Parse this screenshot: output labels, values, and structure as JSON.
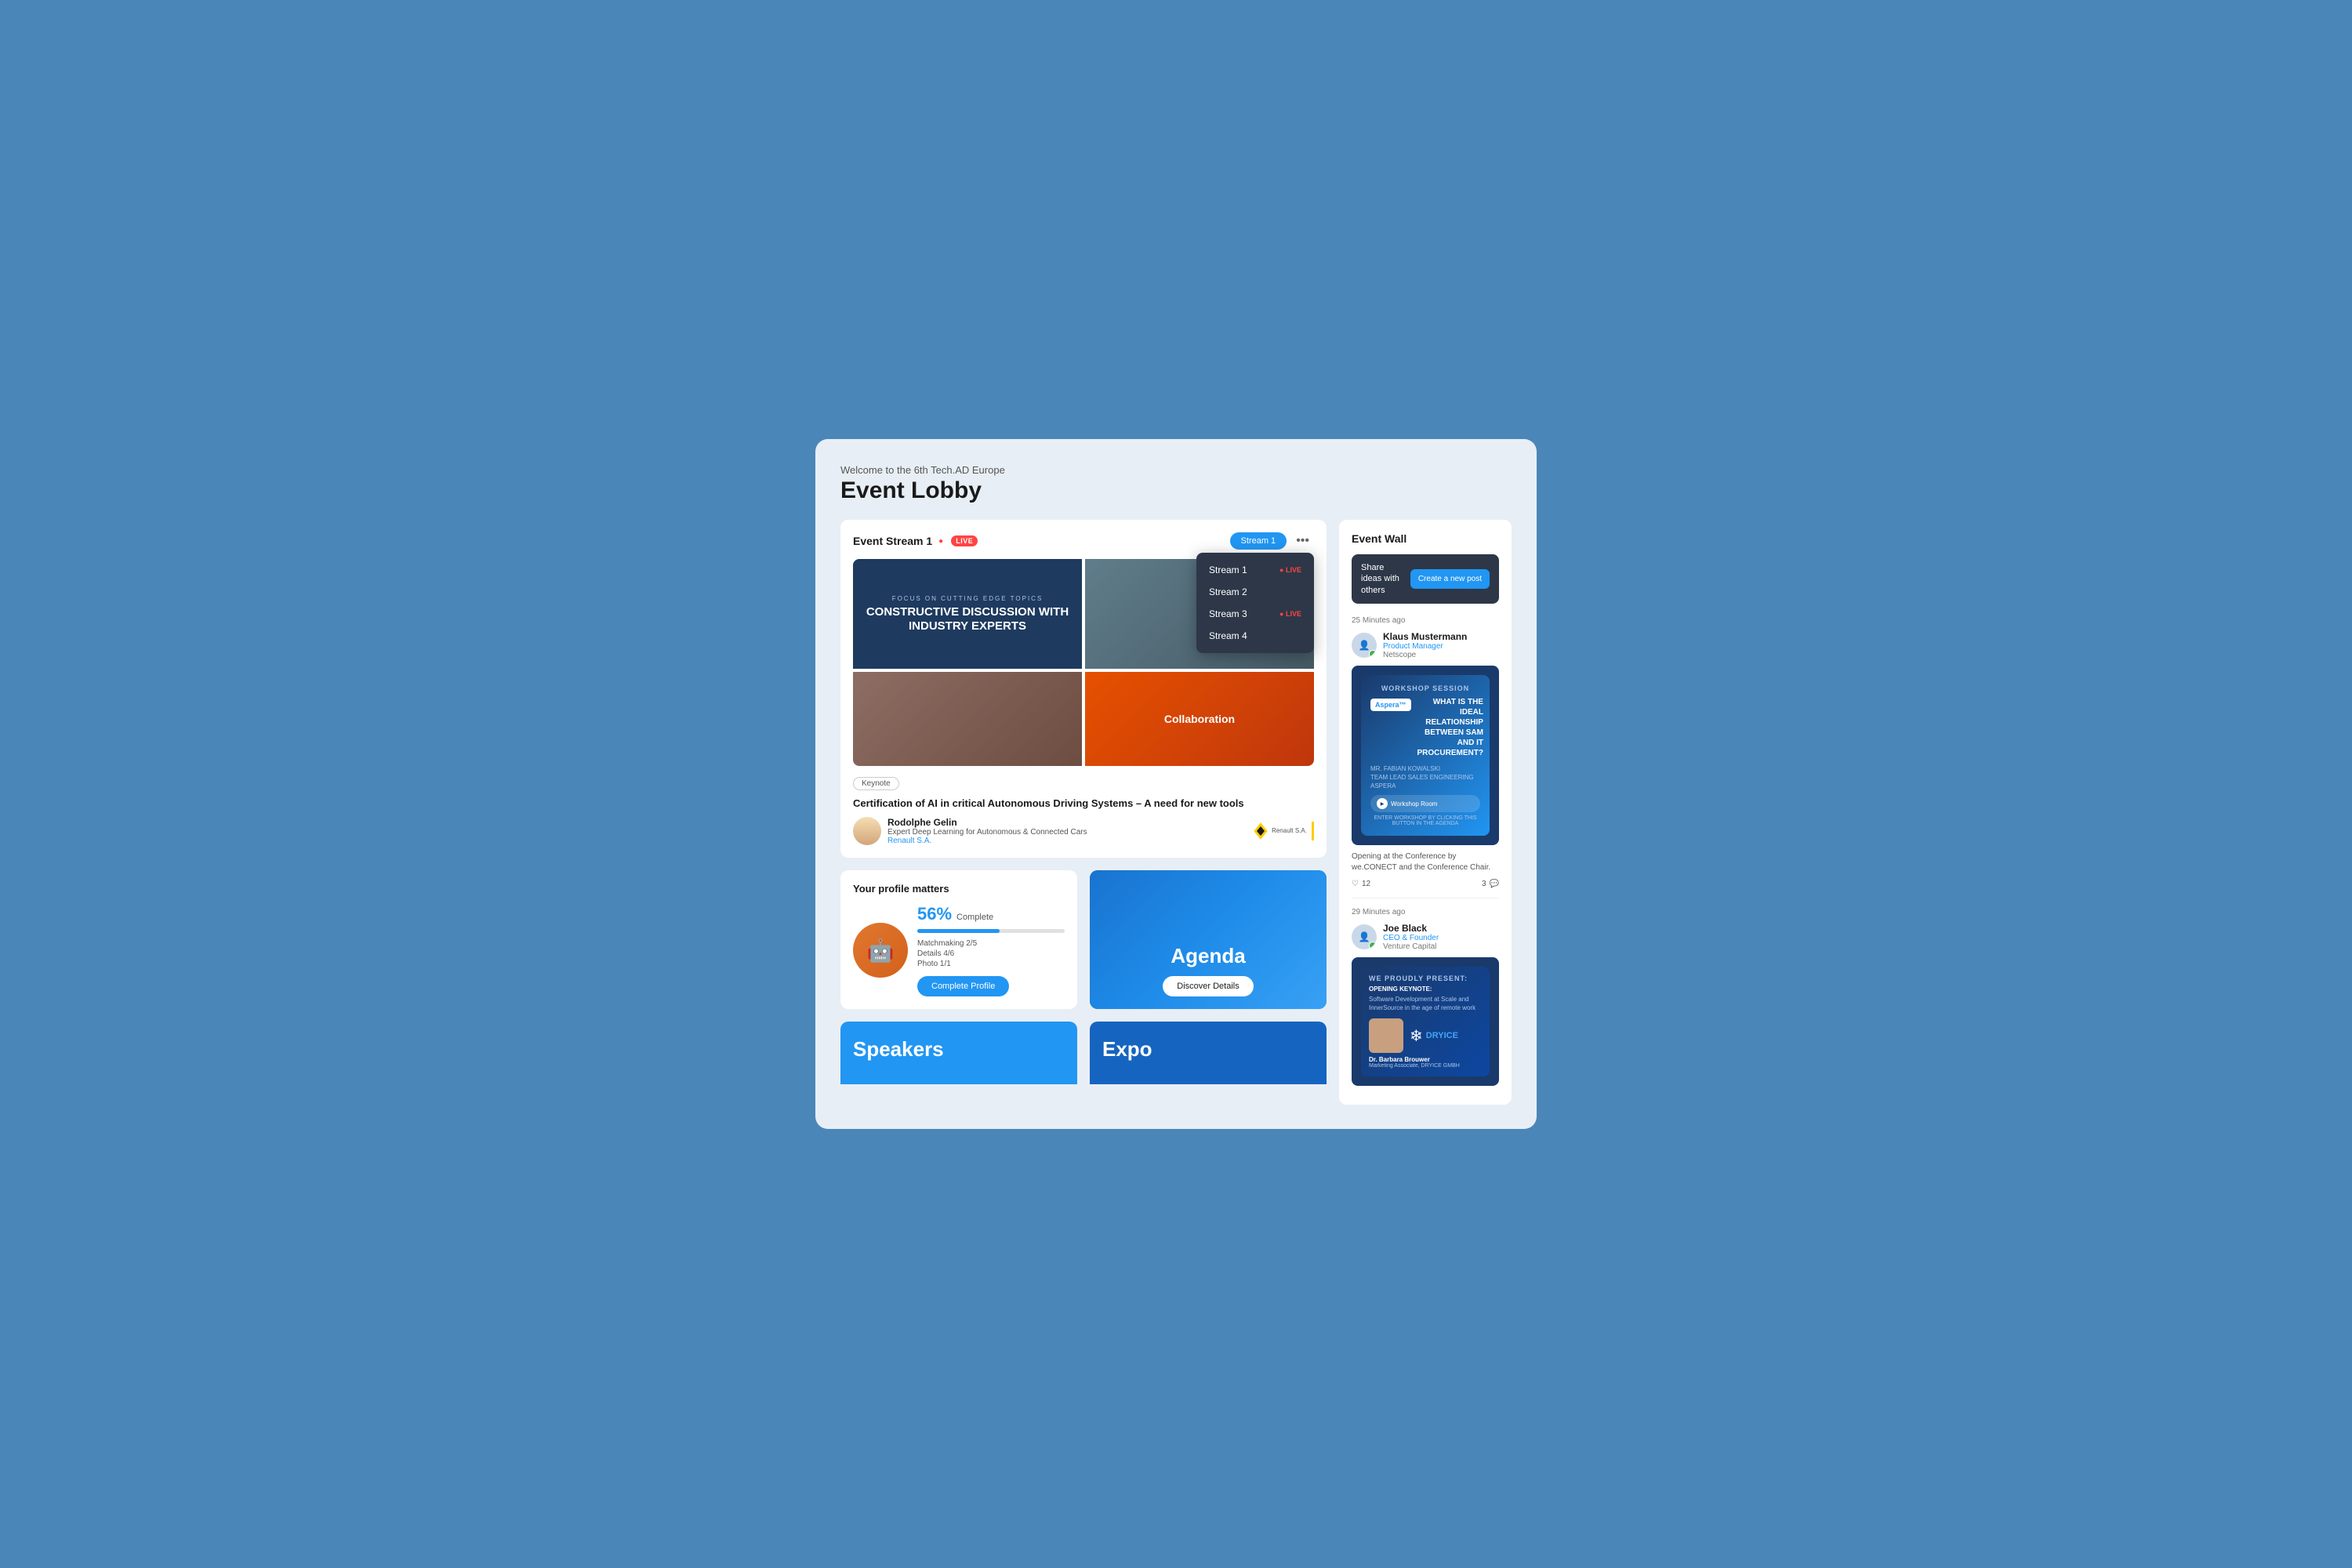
{
  "page": {
    "welcome": "Welcome to the 6th Tech.AD Europe",
    "title": "Event Lobby",
    "bg_color": "#4a86b8"
  },
  "stream": {
    "title": "Event Stream 1",
    "live_label": "LIVE",
    "active_stream": "Stream 1",
    "more_icon": "•••",
    "dropdown": {
      "items": [
        {
          "label": "Stream 1",
          "live": true
        },
        {
          "label": "Stream 2",
          "live": false
        },
        {
          "label": "Stream 3",
          "live": true
        },
        {
          "label": "Stream 4",
          "live": false
        }
      ]
    },
    "video": {
      "focus_text": "FOCUS ON CUTTING EDGE TOPICS",
      "main_text": "CONSTRUCTIVE DISCUSSION WITH INDUSTRY EXPERTS",
      "collab_text": "Collaboration"
    },
    "keynote_tag": "Keynote",
    "session_title": "Certification of AI in critical Autonomous Driving Systems – A need for new tools",
    "speaker_name": "Rodolphe Gelin",
    "speaker_role": "Expert Deep Learning for Autonomous & Connected Cars",
    "speaker_company": "Renault S.A.",
    "renault_label": "Renault S.A."
  },
  "profile": {
    "card_title": "Your profile matters",
    "percent": "56%",
    "complete_label": "Complete",
    "matchmaking": "Matchmaking 2/5",
    "details": "Details 4/6",
    "photo": "Photo 1/1",
    "cta_label": "Complete Profile"
  },
  "agenda": {
    "label": "Agenda",
    "cta_label": "Discover Details"
  },
  "speakers": {
    "label": "Speakers"
  },
  "expo": {
    "label": "Expo"
  },
  "event_wall": {
    "title": "Event Wall",
    "share_text": "Share ideas with others",
    "create_post_label": "Create a new post",
    "posts": [
      {
        "timestamp": "25 Minutes ago",
        "user_name": "Klaus Mustermann",
        "user_role": "Product Manager",
        "user_company": "Netscope",
        "verified": true,
        "post_type": "workshop",
        "card_header": "WORKSHOP SESSION",
        "card_question": "WHAT IS THE IDEAL RELATIONSHIP BETWEEN SAM AND IT PROCUREMENT?",
        "aspera_label": "Aspera™",
        "speaker_label": "MR. FABIAN KOWALSKI",
        "speaker_subrole": "TEAM LEAD SALES ENGINEERING",
        "speaker_company": "ASPERA",
        "room_label": "Workshop Room",
        "enter_text": "ENTER WORKSHOP BY CLICKING THIS BUTTON IN THE AGENDA",
        "description": "Opening at the Conference by we.CONECT and the Conference Chair.",
        "likes": "12",
        "comments": "3"
      },
      {
        "timestamp": "29 Minutes ago",
        "user_name": "Joe Black",
        "user_role": "CEO & Founder",
        "user_company": "Venture Capital",
        "verified": true,
        "post_type": "opening",
        "present_text": "WE PROUDLY PRESENT:",
        "opening_label": "OPENING KEYNOTE:",
        "opening_subtitle": "Software Development at Scale and InnerSource in the age of remote work",
        "speaker_name_card": "Dr. Barbara Brouwer",
        "speaker_role_card": "Marketing Associate, DRYICE GMBH",
        "dryice_label": "DRYICE"
      }
    ]
  }
}
